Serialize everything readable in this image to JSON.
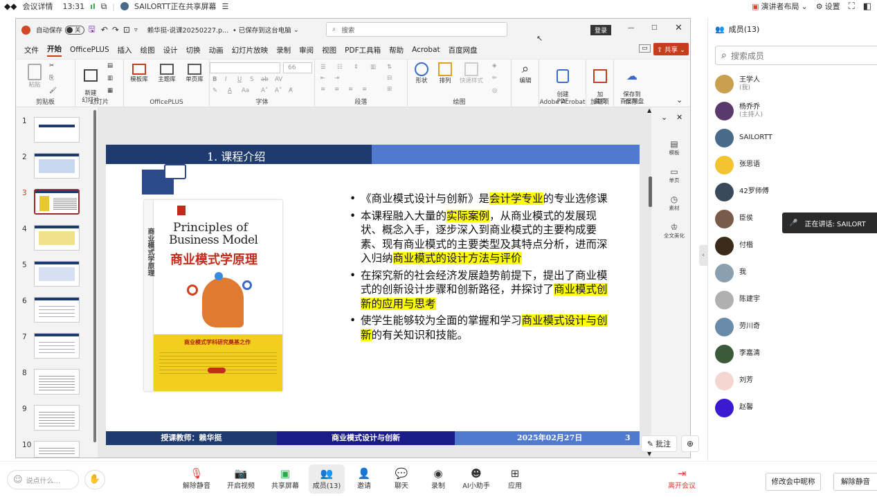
{
  "topbar": {
    "meeting_details": "会议详情",
    "time": "13:31",
    "sharing_status": "SAILORTT正在共享屏幕",
    "layout_label": "演讲者布局",
    "settings_label": "设置"
  },
  "ppt": {
    "autosave_label": "自动保存",
    "autosave_state": "关",
    "file_title": "赖华挺-说课20250227.p...",
    "save_status": "• 已保存到这台电脑",
    "search_placeholder": "搜索",
    "login_label": "登录",
    "menu": [
      "文件",
      "开始",
      "OfficePLUS",
      "插入",
      "绘图",
      "设计",
      "切换",
      "动画",
      "幻灯片放映",
      "录制",
      "审阅",
      "视图",
      "PDF工具箱",
      "帮助",
      "Acrobat",
      "百度网盘"
    ],
    "share_label": "共享",
    "ribbon": {
      "paste": "粘贴",
      "clipboard": "剪贴板",
      "new_slide": "新建\n幻灯片",
      "slides_group": "幻灯片",
      "template_lib": "模板库",
      "theme_lib": "主题库",
      "single_lib": "单页库",
      "officeplus_group": "OfficePLUS",
      "font_size": "66",
      "font_group": "字体",
      "paragraph_group": "段落",
      "shapes": "形状",
      "arrange": "排列",
      "quick_styles": "快速样式",
      "drawing_group": "绘图",
      "editing": "编辑",
      "create_pdf": "创建\nPDF",
      "adobe_group": "Adobe Acrobat",
      "addins": "加\n载项",
      "addins_group": "加载项",
      "save_baidu": "保存到\n百度网盘",
      "save_group": "保存"
    },
    "slide_numbers": [
      "1",
      "2",
      "3",
      "4",
      "5",
      "6",
      "7",
      "8",
      "9",
      "10"
    ],
    "right_panel": [
      "模板",
      "单页",
      "素材",
      "全文美化"
    ],
    "annotate_label": "批注"
  },
  "slide": {
    "header_title": "1. 课程介绍",
    "book": {
      "title_en_1": "Principles of",
      "title_en_2": "Business Model",
      "title_cn": "商业模式学原理",
      "spine": "商业模式学原理",
      "tagline": "商业模式学科研究奠基之作"
    },
    "bullets": [
      {
        "parts": [
          {
            "t": "《商业模式设计与创新》是",
            "h": false
          },
          {
            "t": "会计学专业",
            "h": true
          },
          {
            "t": "的专业选修课",
            "h": false
          }
        ]
      },
      {
        "parts": [
          {
            "t": "本课程融入大量的",
            "h": false
          },
          {
            "t": "实际案例",
            "h": true
          },
          {
            "t": "，从商业模式的发展现状、概念入手，逐步深入到商业模式的主要构成要素、现有商业模式的主要类型及其特点分析，进而深入归纳",
            "h": false
          },
          {
            "t": "商业模式的设计方法与评价",
            "h": true
          }
        ]
      },
      {
        "parts": [
          {
            "t": "在探究新的社会经济发展趋势前提下，提出了商业模式的创新设计步骤和创新路径，并探讨了",
            "h": false
          },
          {
            "t": "商业模式创新的应用与思考",
            "h": true
          }
        ]
      },
      {
        "parts": [
          {
            "t": "使学生能够较为全面的掌握和学习",
            "h": false
          },
          {
            "t": "商业模式设计与创新",
            "h": true
          },
          {
            "t": "的有关知识和技能。",
            "h": false
          }
        ]
      }
    ],
    "footer_teacher": "授课教师：赖华挺",
    "footer_course": "商业模式设计与创新",
    "footer_date": "2025年02月27日",
    "footer_page": "3"
  },
  "members": {
    "header": "成员(13)",
    "search_placeholder": "搜索成员",
    "list": [
      {
        "name": "王学人",
        "sub": "(我)",
        "color": "#c8a050"
      },
      {
        "name": "杨乔乔",
        "sub": "(主持人)",
        "color": "#5a3a6a"
      },
      {
        "name": "SAILORTT",
        "sub": "",
        "color": "#4a6a8a"
      },
      {
        "name": "张思语",
        "sub": "",
        "color": "#f4c430"
      },
      {
        "name": "42罗师傅",
        "sub": "",
        "color": "#3a4a5a"
      },
      {
        "name": "臣侯",
        "sub": "",
        "color": "#7a5a4a"
      },
      {
        "name": "付楷",
        "sub": "",
        "color": "#3a2a1a"
      },
      {
        "name": "我",
        "sub": "",
        "color": "#8aa0b0"
      },
      {
        "name": "陈建宇",
        "sub": "",
        "color": "#b0b0b0"
      },
      {
        "name": "劳川奇",
        "sub": "",
        "color": "#6a8aaa"
      },
      {
        "name": "李嘉清",
        "sub": "",
        "color": "#3a5a3a"
      },
      {
        "name": "刘芳",
        "sub": "",
        "color": "#f6d6d0"
      },
      {
        "name": "赵馨",
        "sub": "",
        "color": "#3a1ad0"
      }
    ],
    "speaking_label": "正在讲话: SAILORT"
  },
  "bottombar": {
    "chat_placeholder": "说点什么...",
    "buttons": [
      "解除静音",
      "开启视频",
      "共享屏幕",
      "成员(13)",
      "邀请",
      "聊天",
      "录制",
      "AI小助手",
      "应用"
    ],
    "leave": "离开会议",
    "rename": "修改会中昵称",
    "unmute": "解除静音"
  },
  "colors": {
    "slide_header": "#1f3a6e",
    "slide_header_right": "#4f7ad0",
    "footer_mid": "#1a1a8a",
    "thumb_selected": "#a4262c",
    "leave_red": "#e53935"
  }
}
